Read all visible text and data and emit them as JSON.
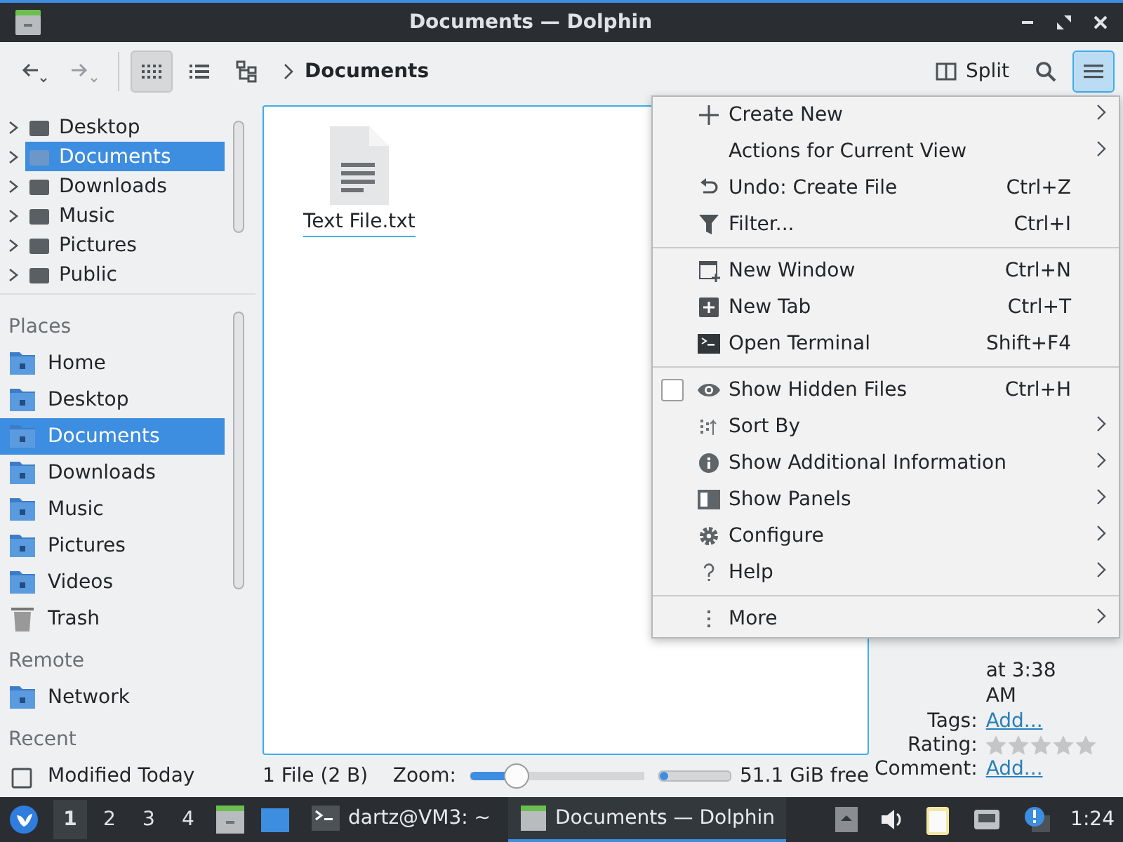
{
  "window": {
    "title": "Documents — Dolphin"
  },
  "toolbar": {
    "view_modes": [
      {
        "selected": true
      },
      {
        "selected": false
      },
      {
        "selected": false
      }
    ],
    "breadcrumb": "Documents",
    "split_label": "Split",
    "menu_button": {
      "selected": true
    }
  },
  "folder_tree": [
    {
      "label": "Desktop",
      "selected": false
    },
    {
      "label": "Documents",
      "selected": true
    },
    {
      "label": "Downloads",
      "selected": false
    },
    {
      "label": "Music",
      "selected": false
    },
    {
      "label": "Pictures",
      "selected": false
    },
    {
      "label": "Public",
      "selected": false
    }
  ],
  "places": [
    {
      "title": "Places",
      "items": [
        {
          "label": "Home",
          "kind": "folder",
          "selected": false
        },
        {
          "label": "Desktop",
          "kind": "folder",
          "selected": false
        },
        {
          "label": "Documents",
          "kind": "folder",
          "selected": true
        },
        {
          "label": "Downloads",
          "kind": "folder",
          "selected": false
        },
        {
          "label": "Music",
          "kind": "folder",
          "selected": false
        },
        {
          "label": "Pictures",
          "kind": "folder",
          "selected": false
        },
        {
          "label": "Videos",
          "kind": "folder",
          "selected": false
        },
        {
          "label": "Trash",
          "kind": "trash",
          "selected": false
        }
      ]
    },
    {
      "title": "Remote",
      "items": [
        {
          "label": "Network",
          "kind": "folder",
          "selected": false
        }
      ]
    },
    {
      "title": "Recent",
      "items": [
        {
          "label": "Modified Today",
          "kind": "recent",
          "selected": false
        }
      ]
    }
  ],
  "files": [
    {
      "name": "Text File.txt",
      "focused": true
    }
  ],
  "status_bar": {
    "summary": "1 File (2 B)",
    "zoom": {
      "label": "Zoom:",
      "level": 0.27
    },
    "disk": {
      "level": 0.12,
      "label": "51.1 GiB free"
    }
  },
  "info_panel": {
    "date_tail": "at 3:38 AM",
    "fields": [
      {
        "label": "Tags:",
        "kind": "link",
        "value": "Add..."
      },
      {
        "label": "Rating:",
        "kind": "rating",
        "stars": 0
      },
      {
        "label": "Comment:",
        "kind": "link",
        "value": "Add..."
      }
    ]
  },
  "menu": {
    "sections": [
      [
        {
          "label": "Create New",
          "submenu": true
        },
        {
          "label": "Actions for Current View",
          "submenu": true
        },
        {
          "label": "Undo: Create File",
          "shortcut": "Ctrl+Z",
          "submenu": false
        },
        {
          "label": "Filter...",
          "shortcut": "Ctrl+I",
          "submenu": false
        }
      ],
      [
        {
          "label": "New Window",
          "shortcut": "Ctrl+N",
          "submenu": false
        },
        {
          "label": "New Tab",
          "shortcut": "Ctrl+T",
          "submenu": false
        },
        {
          "label": "Open Terminal",
          "shortcut": "Shift+F4",
          "submenu": false
        }
      ],
      [
        {
          "label": "Show Hidden Files",
          "kind": "checkbox",
          "checked": false,
          "shortcut": "Ctrl+H",
          "submenu": false
        },
        {
          "label": "Sort By",
          "submenu": true
        },
        {
          "label": "Show Additional Information",
          "submenu": true
        },
        {
          "label": "Show Panels",
          "submenu": true
        },
        {
          "label": "Configure",
          "submenu": true
        },
        {
          "label": "Help",
          "submenu": true
        }
      ],
      [
        {
          "label": "More",
          "submenu": true
        }
      ]
    ]
  },
  "taskbar": {
    "desktops": [
      {
        "label": "1",
        "selected": true
      },
      {
        "label": "2",
        "selected": false
      },
      {
        "label": "3",
        "selected": false
      },
      {
        "label": "4",
        "selected": false
      }
    ],
    "tasks": [
      {
        "label": "dartz@VM3: ~",
        "selected": false
      },
      {
        "label": "Documents — Dolphin",
        "selected": true
      }
    ],
    "clock": "1:24"
  }
}
